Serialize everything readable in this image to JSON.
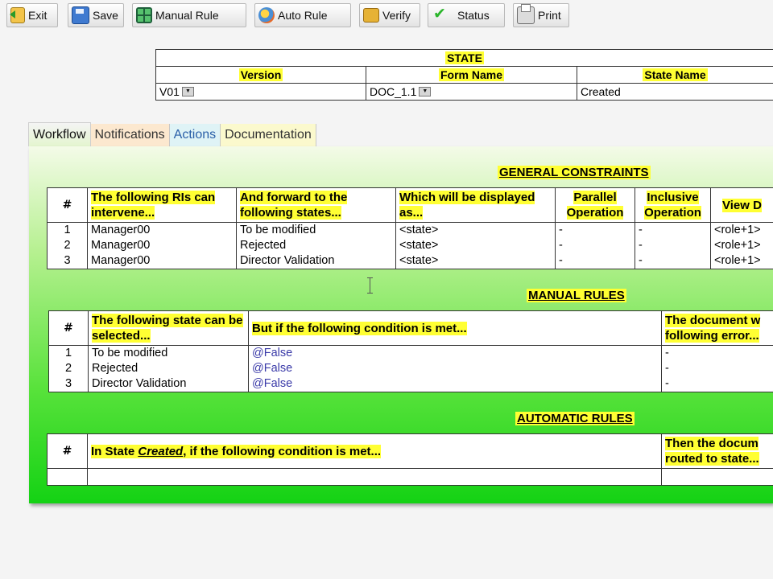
{
  "toolbar": {
    "buttons": [
      {
        "label": "Exit",
        "icon": "exit-icon"
      },
      {
        "label": "Save",
        "icon": "save-icon"
      },
      {
        "label": "Manual Rule",
        "icon": "manual-rule-icon"
      },
      {
        "label": "Auto Rule",
        "icon": "auto-rule-icon"
      },
      {
        "label": "Verify",
        "icon": "verify-icon"
      },
      {
        "label": "Status",
        "icon": "checkmark-icon"
      },
      {
        "label": "Print",
        "icon": "printer-icon"
      }
    ]
  },
  "state": {
    "title": "STATE",
    "headers": [
      "Version",
      "Form Name",
      "State Name"
    ],
    "version": "V01",
    "form_name": "DOC_1.1",
    "state_name": "Created"
  },
  "tabs": [
    "Workflow",
    "Notifications",
    "Actions",
    "Documentation"
  ],
  "general_constraints": {
    "title": "GENERAL CONSTRAINTS",
    "headers": {
      "num": "#",
      "intervene": "The following RIs can intervene...",
      "forward": "And forward to the following states...",
      "displayed": "Which will be displayed as...",
      "parallel": "Parallel Operation",
      "inclusive": "Inclusive Operation",
      "view": "View D"
    },
    "rows": [
      {
        "num": "1",
        "ri": "Manager00",
        "state": "To be modified",
        "display": "<state>",
        "parallel": "-",
        "inclusive": "-",
        "view": "<role+1>"
      },
      {
        "num": "2",
        "ri": "Manager00",
        "state": "Rejected",
        "display": "<state>",
        "parallel": "-",
        "inclusive": "-",
        "view": "<role+1>"
      },
      {
        "num": "3",
        "ri": "Manager00",
        "state": "Director Validation",
        "display": "<state>",
        "parallel": "-",
        "inclusive": "-",
        "view": "<role+1>"
      }
    ]
  },
  "manual_rules": {
    "title": "MANUAL RULES",
    "headers": {
      "num": "#",
      "state": "The following state can be selected...",
      "condition": "But if the following condition is met...",
      "error": "The document w following error..."
    },
    "rows": [
      {
        "num": "1",
        "state": "To be modified",
        "condition": "@False",
        "error": "-"
      },
      {
        "num": "2",
        "state": "Rejected",
        "condition": "@False",
        "error": "-"
      },
      {
        "num": "3",
        "state": "Director Validation",
        "condition": "@False",
        "error": "-"
      }
    ]
  },
  "automatic_rules": {
    "title": "AUTOMATIC RULES",
    "headers": {
      "num": "#",
      "condition_prefix": "In State ",
      "condition_state": "Created",
      "condition_suffix": ", if the following condition is met...",
      "routed": "Then the docum routed to state..."
    }
  },
  "colors": {
    "highlight": "#ffff33",
    "panel_green": "#14d214",
    "condition_text": "#3a3aa8"
  }
}
